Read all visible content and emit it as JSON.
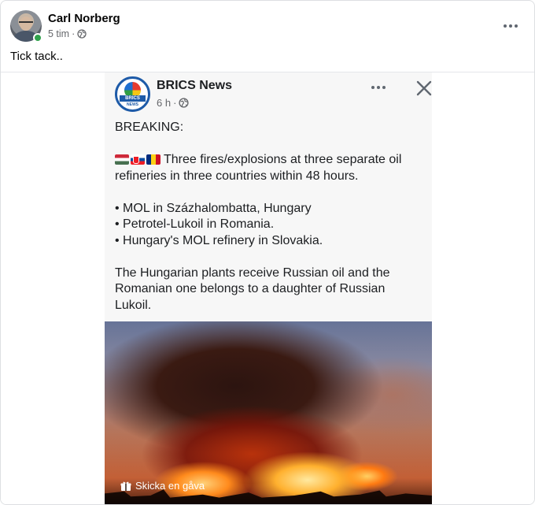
{
  "post": {
    "author": "Carl Norberg",
    "time": "5 tim",
    "separator": "·",
    "text": "Tick tack.."
  },
  "shared": {
    "source_name": "BRICS News",
    "source_time": "6 h",
    "separator": "·",
    "logo_text": "BRICS",
    "logo_subtext": "NEWS",
    "lines": {
      "headline": "BREAKING:",
      "intro_1": "Three fires/explosions at three separate oil",
      "intro_2": "refineries in three  countries within 48 hours.",
      "bullet_1": "• MOL in Százhalombatta, Hungary",
      "bullet_2": "• Petrotel-Lukoil in Romania.",
      "bullet_3": "• Hungary's MOL refinery in Slovakia.",
      "outro_1": "The Hungarian plants receive Russian oil and the",
      "outro_2": "Romanian one belongs to a daughter of Russian",
      "outro_3": "Lukoil."
    },
    "flags": [
      "hungary-flag-icon",
      "slovakia-flag-icon",
      "romania-flag-icon"
    ],
    "gift_label": "Skicka en gåva"
  },
  "icons": {
    "more": "more-options-icon",
    "globe": "globe-icon",
    "close": "close-icon",
    "gift": "gift-icon"
  },
  "colors": {
    "online": "#31a24c",
    "meta_text": "#65676b",
    "brics_blue": "#1e5ba8"
  }
}
